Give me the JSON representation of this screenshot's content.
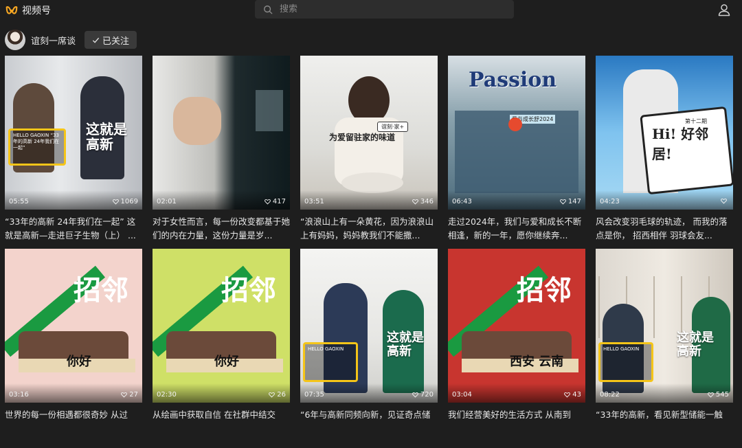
{
  "app": {
    "name": "视频号",
    "brand_color": "#f5a623"
  },
  "search": {
    "placeholder": "搜索"
  },
  "account": {
    "name": "谊刻一席谈",
    "follow_label": "已关注"
  },
  "videos": [
    {
      "duration": "05:55",
      "likes": "1069",
      "title": "“33年的高新 24年我们在一起” 这就是高新—走进巨子生物（上） ...",
      "thumb": "lab",
      "overlay": "这就是高新",
      "box": "HELLO GAOXIN “33年的高新 24年我们在一起”"
    },
    {
      "duration": "02:01",
      "likes": "417",
      "title": "对于女性而言，每一份改变都基于她们的内在力量，这份力量是岁...",
      "thumb": "dark",
      "overlay": "",
      "box": ""
    },
    {
      "duration": "03:51",
      "likes": "346",
      "title": "“浪浪山上有一朵黄花，因为浪浪山上有妈妈，妈妈教我们不能撒...",
      "thumb": "kitchen",
      "overlay": "为爱留驻家的味道",
      "box": "谊刻·家+"
    },
    {
      "duration": "06:43",
      "likes": "147",
      "title": "走过2024年，我们与爱和成长不断相逢，新的一年，愿你继续奔...",
      "thumb": "passion",
      "overlay": "Passion",
      "box": "爱与成长舒2024"
    },
    {
      "duration": "04:23",
      "likes": "",
      "title": "风会改变羽毛球的轨迹， 而我的落点是你， 招西相伴 羽球会友...",
      "thumb": "hi",
      "overlay": "Hi! 好邻居!",
      "box": "第十二期"
    },
    {
      "duration": "03:16",
      "likes": "27",
      "title": "世界的每一份相遇都很奇妙 从过",
      "thumb": "pink",
      "overlay": "招邻",
      "box": "你好"
    },
    {
      "duration": "02:30",
      "likes": "26",
      "title": "从绘画中获取自信 在社群中结交",
      "thumb": "lime",
      "overlay": "招邻",
      "box": "你好"
    },
    {
      "duration": "07:35",
      "likes": "720",
      "title": "“6年与高新同频向新，见证奇点储",
      "thumb": "office",
      "overlay": "这就是高新",
      "box": "HELLO GAOXIN"
    },
    {
      "duration": "03:04",
      "likes": "43",
      "title": "我们经营美好的生活方式 从南到",
      "thumb": "red",
      "overlay": "招邻",
      "box": "西安 云南"
    },
    {
      "duration": "08:22",
      "likes": "545",
      "title": "“33年的高新，看见新型储能一触",
      "thumb": "shelf",
      "overlay": "这就是高新",
      "box": "HELLO GAOXIN"
    }
  ]
}
